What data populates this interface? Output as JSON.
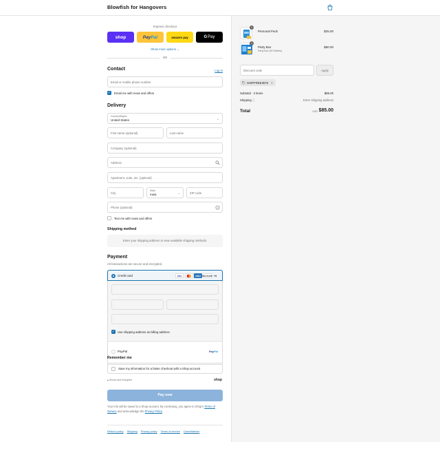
{
  "header": {
    "brand": "Blowfish for Hangovers",
    "cart_icon": "shopping-bag-icon"
  },
  "express": {
    "title": "Express checkout",
    "buttons": {
      "shop": "shop",
      "paypal_a": "Pay",
      "paypal_b": "Pal",
      "amazon": "amazon pay",
      "gpay_g": "G",
      "gpay": "Pay"
    },
    "more_options": "Show more options",
    "or": "OR"
  },
  "contact": {
    "title": "Contact",
    "login": "Log in",
    "email_placeholder": "Email or mobile phone number",
    "news_label": "Email me with news and offers"
  },
  "delivery": {
    "title": "Delivery",
    "country_label": "Country/Region",
    "country_value": "United States",
    "first_name": "First name (optional)",
    "last_name": "Last name",
    "company": "Company (optional)",
    "address": "Address",
    "apartment": "Apartment, suite, etc. (optional)",
    "city": "City",
    "state_label": "State",
    "state_value": "Iowa",
    "zip": "ZIP code",
    "phone": "Phone (optional)",
    "text_label": "Text me with news and offers"
  },
  "shipping": {
    "title": "Shipping method",
    "message": "Enter your shipping address to view available shipping methods."
  },
  "payment": {
    "title": "Payment",
    "subtitle": "All transactions are secure and encrypted.",
    "credit_card": "Credit card",
    "cards": {
      "visa": "VISA",
      "amex": "AMEX",
      "discover": "DISCOVER",
      "more": "+4"
    },
    "billing_label": "Use shipping address as billing address",
    "paypal": "PayPal",
    "paypal_logo_a": "Pay",
    "paypal_logo_b": "Pal"
  },
  "remember": {
    "title": "Remember me",
    "label": "Save my information for a faster checkout with a Shop account",
    "secure": "Secure and encrypted",
    "shop": "shop"
  },
  "pay_now": "Pay now",
  "legal": {
    "line1": "Your info will be saved to a Shop account. By continuing, you agree to Shop's",
    "terms": "Terms of Service",
    "mid": "and acknowledge the",
    "privacy": "Privacy Policy",
    "end": "."
  },
  "footer": {
    "refund": "Refund policy",
    "shipping": "Shipping",
    "privacy": "Privacy policy",
    "terms": "Terms of service",
    "cancellations": "Cancellations"
  },
  "summary": {
    "items": [
      {
        "name": "Personal Pack",
        "sub": "",
        "price": "$25.00",
        "qty": "1"
      },
      {
        "name": "Party Box",
        "sub": "Party Box (90 Tablets)",
        "price": "$60.00",
        "qty": "1"
      }
    ],
    "discount_placeholder": "Discount code",
    "apply": "Apply",
    "tag": "SHIPFREE4576",
    "subtotal_label": "Subtotal · 2 items",
    "subtotal": "$85.00",
    "shipping_label": "Shipping",
    "shipping_value": "Enter shipping address",
    "total_label": "Total",
    "currency": "USD",
    "total": "$85.00"
  }
}
